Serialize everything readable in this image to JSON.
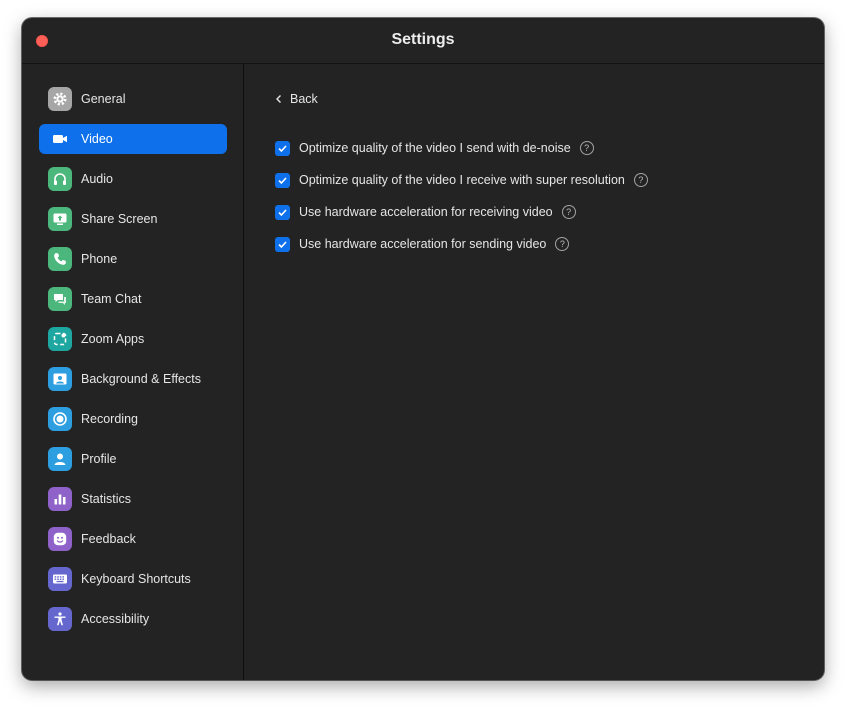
{
  "window": {
    "title": "Settings"
  },
  "sidebar": {
    "items": [
      {
        "label": "General",
        "icon": "gear-icon",
        "color": "#a6a6a6"
      },
      {
        "label": "Video",
        "icon": "video-camera-icon",
        "color": "#0e71eb",
        "selected": true
      },
      {
        "label": "Audio",
        "icon": "headphones-icon",
        "color": "#4cb77c"
      },
      {
        "label": "Share Screen",
        "icon": "share-screen-icon",
        "color": "#4cb77c"
      },
      {
        "label": "Phone",
        "icon": "phone-icon",
        "color": "#4cb77c"
      },
      {
        "label": "Team Chat",
        "icon": "chat-icon",
        "color": "#4cb77c"
      },
      {
        "label": "Zoom Apps",
        "icon": "apps-icon",
        "color": "#1ea7a0"
      },
      {
        "label": "Background & Effects",
        "icon": "background-icon",
        "color": "#2d9fe0"
      },
      {
        "label": "Recording",
        "icon": "record-icon",
        "color": "#2d9fe0"
      },
      {
        "label": "Profile",
        "icon": "person-icon",
        "color": "#2d9fe0"
      },
      {
        "label": "Statistics",
        "icon": "bar-chart-icon",
        "color": "#8e62c8"
      },
      {
        "label": "Feedback",
        "icon": "smiley-icon",
        "color": "#8e62c8"
      },
      {
        "label": "Keyboard Shortcuts",
        "icon": "keyboard-icon",
        "color": "#6567cf"
      },
      {
        "label": "Accessibility",
        "icon": "accessibility-icon",
        "color": "#6567cf"
      }
    ]
  },
  "content": {
    "back_label": "Back",
    "options": [
      {
        "label": "Optimize quality of the video I send with de-noise",
        "checked": true
      },
      {
        "label": "Optimize quality of the video I receive with super resolution",
        "checked": true
      },
      {
        "label": "Use hardware acceleration for receiving video",
        "checked": true
      },
      {
        "label": "Use hardware acceleration for sending video",
        "checked": true
      }
    ],
    "help_glyph": "?"
  },
  "colors": {
    "accent": "#0e71eb",
    "window_bg": "#232324",
    "close_button": "#fe5f57"
  }
}
